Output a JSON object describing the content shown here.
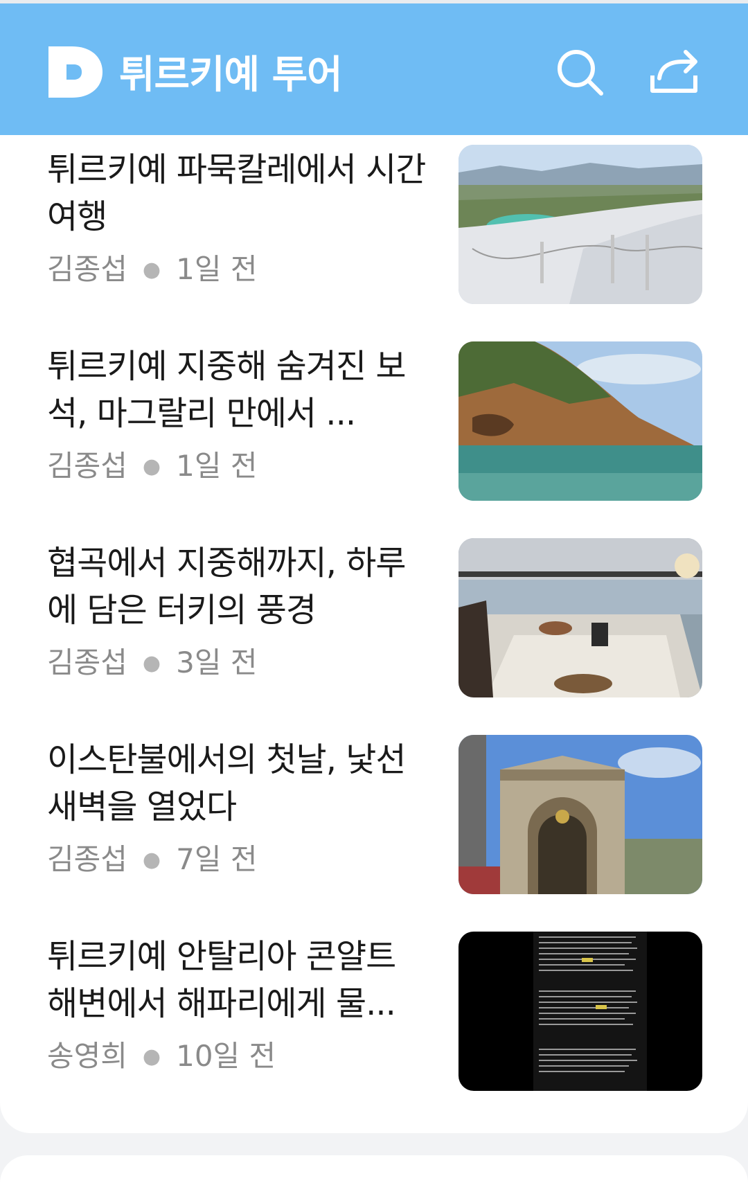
{
  "header": {
    "title": "튀르키예 투어",
    "logo_letter": "D",
    "background": "#6fbcf4"
  },
  "icons": {
    "search": "search-icon",
    "share": "share-icon"
  },
  "articles": [
    {
      "title": "튀르키예 파묵칼레에서 시간 여행",
      "author": "김종섭",
      "time": "1일 전",
      "thumbnail": "pamukkale-terraces"
    },
    {
      "title": "튀르키예 지중해 숨겨진 보석, 마그랄리 만에서 ...",
      "author": "김종섭",
      "time": "1일 전",
      "thumbnail": "coastal-cliff"
    },
    {
      "title": "협곡에서 지중해까지, 하루에 담은 터키의 풍경",
      "author": "김종섭",
      "time": "3일 전",
      "thumbnail": "restaurant-terrace"
    },
    {
      "title": "이스탄불에서의 첫날, 낯선 새벽을 열었다",
      "author": "김종섭",
      "time": "7일 전",
      "thumbnail": "bazaar-gate"
    },
    {
      "title": "튀르키예 안탈리아 콘얄트 해변에서 해파리에게 물...",
      "author": "송영희",
      "time": "10일 전",
      "thumbnail": "text-screenshot"
    }
  ]
}
